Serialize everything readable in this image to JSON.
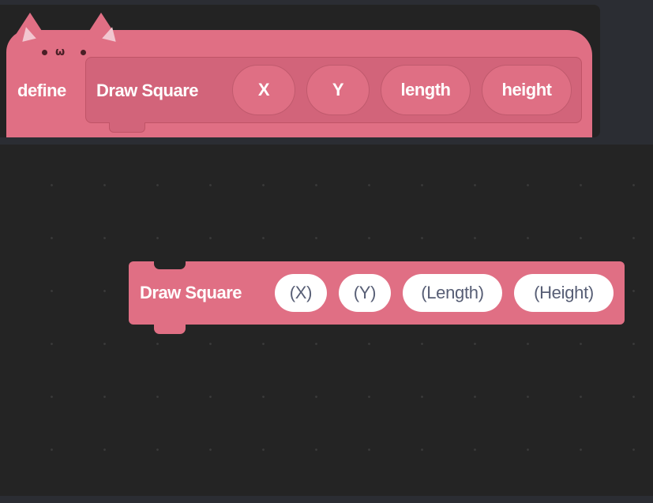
{
  "define_block": {
    "define_label": "define",
    "title": "Draw Square",
    "params": [
      "X",
      "Y",
      "length",
      "height"
    ],
    "color": "#e06f84",
    "decoration_icon": "cat-ears-face"
  },
  "call_block": {
    "title": "Draw Square",
    "args": [
      "(X)",
      "(Y)",
      "(Length)",
      "(Height)"
    ],
    "color": "#e06f84"
  }
}
